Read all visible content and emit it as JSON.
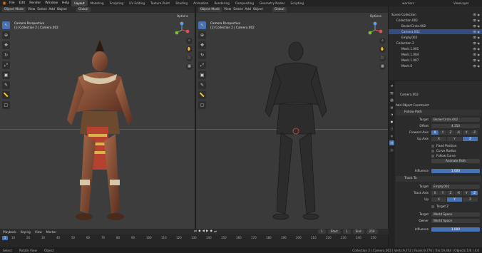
{
  "menubar": {
    "menus": [
      "File",
      "Edit",
      "Render",
      "Window",
      "Help"
    ],
    "workspaces": [
      "Layout",
      "Modeling",
      "Sculpting",
      "UV Editing",
      "Texture Paint",
      "Shading",
      "Animation",
      "Rendering",
      "Compositing",
      "Geometry Nodes",
      "Scripting"
    ],
    "active_workspace": "Layout",
    "scene": "warriors",
    "view_layer": "ViewLayer"
  },
  "left_viewport": {
    "mode": "Object Mode",
    "menus": [
      "View",
      "Select",
      "Add",
      "Object"
    ],
    "transform": "Global",
    "options": "Options",
    "overlay_line1": "Camera Perspective",
    "overlay_line2": "(1) Collection 2 | Camera.002"
  },
  "right_viewport": {
    "mode": "Object Mode",
    "menus": [
      "View",
      "Select",
      "Add",
      "Object"
    ],
    "transform": "Global",
    "options": "Options",
    "overlay_line1": "Camera Perspective",
    "overlay_line2": "(1) Collection 2 | Camera.002"
  },
  "timeline": {
    "menus": [
      "Playback",
      "Keying",
      "View",
      "Marker"
    ],
    "current_frame": "1",
    "start_label": "Start",
    "start": "1",
    "end_label": "End",
    "end": "250",
    "ticks": [
      "10",
      "20",
      "30",
      "40",
      "50",
      "60",
      "70",
      "80",
      "90",
      "100",
      "110",
      "120",
      "130",
      "140",
      "150",
      "160",
      "170",
      "180",
      "190",
      "200",
      "210",
      "220",
      "230",
      "240",
      "250"
    ]
  },
  "statusbar": {
    "left": [
      "Select",
      "Rotate View",
      "Object"
    ],
    "right": "Collection 2 | Camera.002 | Verts:9,772 | Faces:9,770 | Tris:19,484 | Objects:1/6 | 4.0"
  },
  "outliner": {
    "rows": [
      {
        "label": "Scene Collection",
        "indent": 0,
        "selected": false
      },
      {
        "label": "Collection.002",
        "indent": 1,
        "selected": false
      },
      {
        "label": "BezierCircle.002",
        "indent": 2,
        "selected": false
      },
      {
        "label": "Camera.002",
        "indent": 2,
        "selected": true
      },
      {
        "label": "Empty.002",
        "indent": 2,
        "selected": false
      },
      {
        "label": "Collection 2",
        "indent": 1,
        "selected": false
      },
      {
        "label": "Mesh.1.001",
        "indent": 2,
        "selected": false
      },
      {
        "label": "Mesh.1.004",
        "indent": 2,
        "selected": false
      },
      {
        "label": "Mesh.1.007",
        "indent": 2,
        "selected": false
      },
      {
        "label": "Mesh.0",
        "indent": 2,
        "selected": false
      }
    ]
  },
  "properties": {
    "object_name": "Camera.002",
    "add_constraint": "Add Object Constraint",
    "follow_path": {
      "name": "Follow Path",
      "target_label": "Target",
      "target": "BezierCircle.002",
      "offset_label": "Offset",
      "offset": "4.250",
      "forward_label": "Forward Axis",
      "up_label": "Up Axis",
      "axes_forward": [
        "X",
        "Y",
        "Z",
        "-X",
        "-Y",
        "-Z"
      ],
      "axes_up": [
        "X",
        "Y",
        "Z"
      ],
      "fixed_position": "Fixed Position",
      "curve_radius": "Curve Radius",
      "follow_curve": "Follow Curve",
      "animate_path": "Animate Path",
      "influence_label": "Influence",
      "influence": "1.000"
    },
    "track_to": {
      "name": "Track To",
      "target_label": "Target",
      "target": "Empty.002",
      "track_axis_label": "Track Axis",
      "up_label": "Up",
      "axes_track": [
        "X",
        "Y",
        "Z",
        "-X",
        "-Y",
        "-Z"
      ],
      "axes_up": [
        "X",
        "Y",
        "Z"
      ],
      "target_z": "Target Z",
      "target_space_label": "Target",
      "target_space": "World Space",
      "owner_label": "Owner",
      "owner_space": "World Space",
      "influence_label": "Influence",
      "influence": "1.000"
    }
  },
  "colors": {
    "accent": "#4772b3",
    "orange": "#e87d0d"
  }
}
